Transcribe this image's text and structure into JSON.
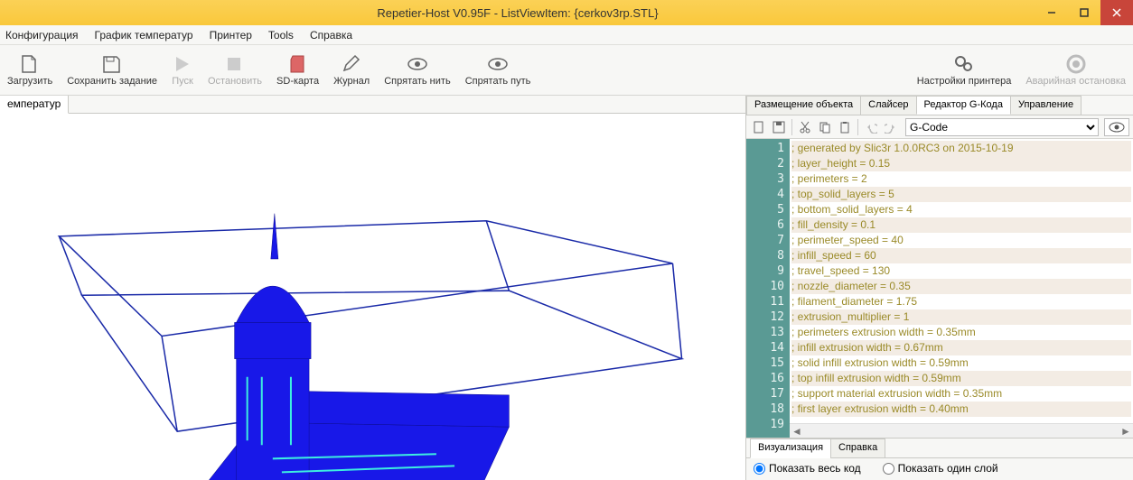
{
  "window": {
    "title": "Repetier-Host V0.95F - ListViewItem: {cerkov3rp.STL}"
  },
  "menu": [
    "Конфигурация",
    "График температур",
    "Принтер",
    "Tools",
    "Справка"
  ],
  "toolbar": {
    "load": "Загрузить",
    "save": "Сохранить задание",
    "run": "Пуск",
    "stop": "Остановить",
    "sd": "SD-карта",
    "log": "Журнал",
    "hide_thread": "Спрятать нить",
    "hide_path": "Спрятать путь",
    "printer_settings": "Настройки принтера",
    "emergency": "Аварийная остановка"
  },
  "left_tab": "емператур",
  "right_tabs": {
    "placement": "Размещение объекта",
    "slicer": "Слайсер",
    "gcode": "Редактор G-Кода",
    "control": "Управление"
  },
  "editor_dropdown": "G-Code",
  "gcode_lines": [
    "; generated by Slic3r 1.0.0RC3 on 2015-10-19 ",
    "",
    "; layer_height = 0.15",
    "; perimeters = 2",
    "; top_solid_layers = 5",
    "; bottom_solid_layers = 4",
    "; fill_density = 0.1",
    "; perimeter_speed = 40",
    "; infill_speed = 60",
    "; travel_speed = 130",
    "; nozzle_diameter = 0.35",
    "; filament_diameter = 1.75",
    "; extrusion_multiplier = 1",
    "; perimeters extrusion width = 0.35mm",
    "; infill extrusion width = 0.67mm",
    "; solid infill extrusion width = 0.59mm",
    "; top infill extrusion width = 0.59mm",
    "; support material extrusion width = 0.35mm",
    "; first layer extrusion width = 0.40mm"
  ],
  "viz_tabs": {
    "viz": "Визуализация",
    "help": "Справка"
  },
  "viz_opts": {
    "all": "Показать весь код",
    "one": "Показать один слой"
  },
  "chart_data": {
    "type": "table",
    "title": "Slic3r settings (G-code header)",
    "generated_by": "Slic3r 1.0.0RC3",
    "generated_on": "2015-10-19",
    "settings": {
      "layer_height": 0.15,
      "perimeters": 2,
      "top_solid_layers": 5,
      "bottom_solid_layers": 4,
      "fill_density": 0.1,
      "perimeter_speed": 40,
      "infill_speed": 60,
      "travel_speed": 130,
      "nozzle_diameter": 0.35,
      "filament_diameter": 1.75,
      "extrusion_multiplier": 1,
      "perimeters_extrusion_width_mm": 0.35,
      "infill_extrusion_width_mm": 0.67,
      "solid_infill_extrusion_width_mm": 0.59,
      "top_infill_extrusion_width_mm": 0.59,
      "support_material_extrusion_width_mm": 0.35,
      "first_layer_extrusion_width_mm": 0.4
    }
  }
}
